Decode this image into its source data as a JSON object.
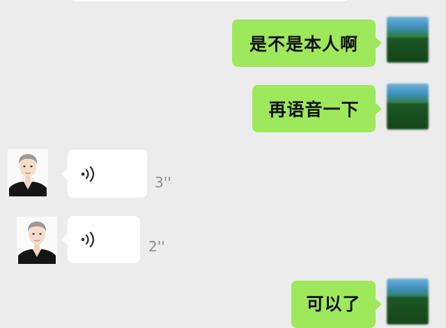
{
  "chat": {
    "messages": [
      {
        "from": "me",
        "type": "text",
        "text": "是不是本人啊"
      },
      {
        "from": "me",
        "type": "text",
        "text": "再语音一下"
      },
      {
        "from": "other",
        "type": "voice",
        "duration": "3''",
        "icon": "voice-wave-icon"
      },
      {
        "from": "other",
        "type": "voice",
        "duration": "2''",
        "icon": "voice-wave-icon"
      },
      {
        "from": "me",
        "type": "text",
        "text": "可以了"
      }
    ]
  },
  "colors": {
    "background": "#ececec",
    "outgoing_bubble": "#9ee85c",
    "incoming_bubble": "#ffffff",
    "duration_text": "#8e8e8e"
  }
}
